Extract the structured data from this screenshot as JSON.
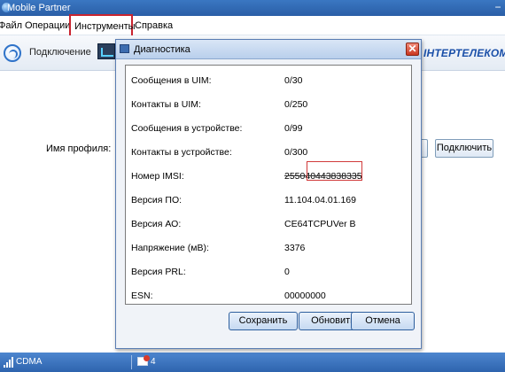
{
  "app": {
    "title": "Mobile Partner",
    "minimize_glyph": "−",
    "menu": [
      "Файл",
      "Операции",
      "Инструменты",
      "Справка"
    ]
  },
  "toolbar": {
    "connect_label": "Подключение",
    "brand": "ІНТЕРТЕЛЕКОМ"
  },
  "profile": {
    "label": "Имя профиля:",
    "connect_button": "Подключить"
  },
  "status": {
    "network": "CDMA",
    "sms_count": "4"
  },
  "dialog": {
    "title": "Диагностика",
    "close_glyph": "✕",
    "rows": [
      {
        "label": "Сообщения в UIM:",
        "value": "0/30"
      },
      {
        "label": "Контакты в UIM:",
        "value": "0/250"
      },
      {
        "label": "Сообщения в устройстве:",
        "value": "0/99"
      },
      {
        "label": "Контакты в устройстве:",
        "value": "0/300"
      },
      {
        "label": "Номер IMSI:",
        "value": "255040443838335"
      },
      {
        "label": "Версия ПО:",
        "value": "11.104.04.01.169"
      },
      {
        "label": "Версия АО:",
        "value": "CE64TCPUVer B"
      },
      {
        "label": "Напряжение (мВ):",
        "value": "3376"
      },
      {
        "label": "Версия PRL:",
        "value": "0"
      },
      {
        "label": "ESN:",
        "value": "00000000"
      }
    ],
    "buttons": {
      "save": "Сохранить",
      "refresh": "Обновить",
      "cancel": "Отмена"
    }
  },
  "colors": {
    "titlebar": "#2a5ea6",
    "highlight_border": "#c9242f",
    "statusbar": "#2e64ae",
    "brand": "#1a4fa8"
  }
}
